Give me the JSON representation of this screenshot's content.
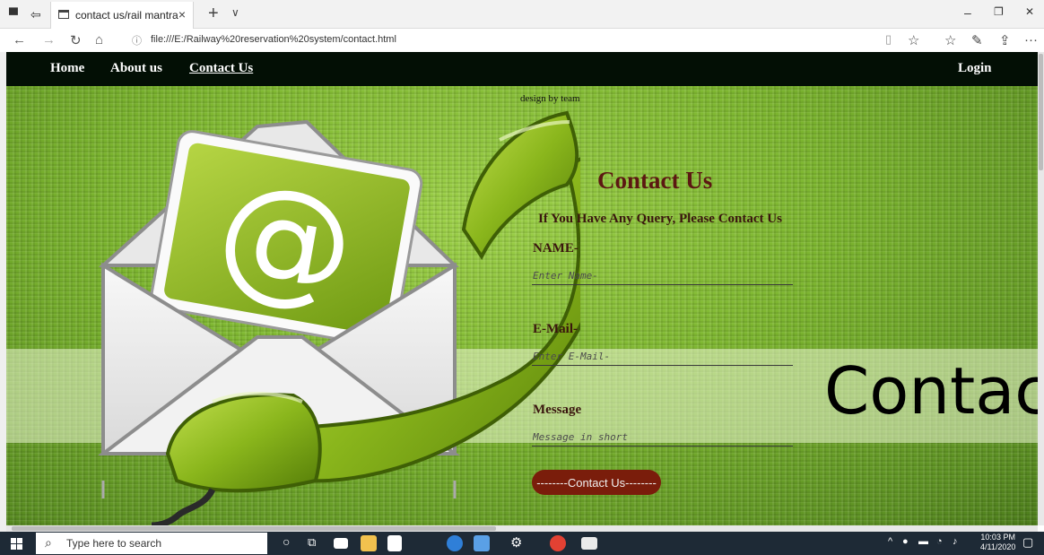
{
  "browser": {
    "tab_title": "contact us/rail mantra",
    "tab_close": "×",
    "new_tab": "+",
    "tab_list": "∨",
    "window_min": "–",
    "window_max": "❐",
    "window_close": "✕",
    "url": "file:///E:/Railway%20reservation%20system/contact.html"
  },
  "navbar": {
    "home": "Home",
    "about": "About us",
    "contact": "Contact Us",
    "login": "Login"
  },
  "page": {
    "credit": "design by team",
    "hero_text": "Contac"
  },
  "form": {
    "title": "Contact Us",
    "subtitle": "If You Have Any Query, Please Contact Us",
    "name_label": "NAME-",
    "name_placeholder": "Enter Name-",
    "email_label": "E-Mail-",
    "email_placeholder": "Enter E-Mail-",
    "message_label": "Message",
    "message_placeholder": "Message in short",
    "submit_label": "--------Contact Us--------"
  },
  "taskbar": {
    "search_placeholder": "Type here to search",
    "time": "10:03 PM",
    "date": "4/11/2020"
  }
}
